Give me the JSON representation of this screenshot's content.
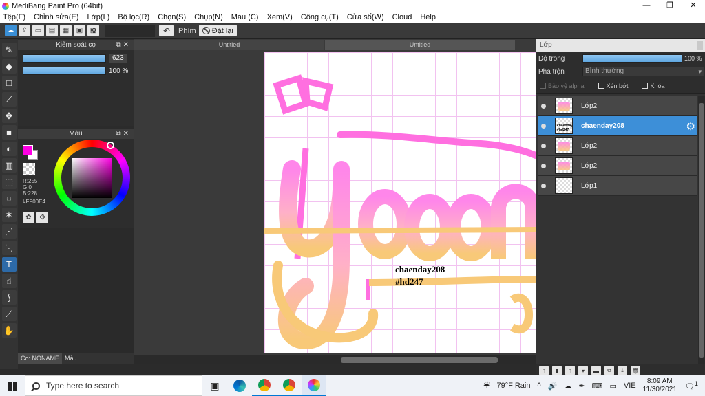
{
  "window": {
    "title": "MediBang Paint Pro (64bit)",
    "minimize": "—",
    "maximize": "❐",
    "close": "✕"
  },
  "menu": [
    "Tệp(F)",
    "Chỉnh sửa(E)",
    "Lớp(L)",
    "Bộ lọc(R)",
    "Chọn(S)",
    "Chụp(N)",
    "Màu (C)",
    "Xem(V)",
    "Công cụ(T)",
    "Cửa sổ(W)",
    "Cloud",
    "Help"
  ],
  "toolbar": {
    "phim_label": "Phím",
    "reset_label": "Đặt lại"
  },
  "brush_panel": {
    "title": "Kiểm soát cọ",
    "size_value": "623",
    "opacity_value": "100 %"
  },
  "color_panel": {
    "title": "Màu",
    "r": "R:255",
    "g": "G:0",
    "b": "B:228",
    "hex": "#FF00E4",
    "primary_color": "#FF00E4",
    "secondary_color": "#FFFFFF"
  },
  "bottom_tabs": {
    "brush": "Co: NONAME",
    "color": "Màu"
  },
  "documents": {
    "tab1": "Untitled",
    "tab2": "Untitled"
  },
  "canvas_text": {
    "line1": "chaenday208",
    "line2": "#hd247"
  },
  "layer_panel": {
    "title": "Lớp",
    "opacity_label": "Độ trong",
    "opacity_value": "100 %",
    "blend_label": "Pha trộn",
    "blend_value": "Bình thường",
    "protect_alpha": "Bảo vệ alpha",
    "clipping": "Xén bớt",
    "lock": "Khóa",
    "layers": [
      {
        "name": "Lớp2"
      },
      {
        "name": "chaenday208",
        "thumb_text": "chaenday208 #hd247"
      },
      {
        "name": "Lớp2"
      },
      {
        "name": "Lớp2"
      },
      {
        "name": "Lớp1"
      }
    ]
  },
  "taskbar": {
    "search_placeholder": "Type here to search",
    "weather": "79°F  Rain",
    "lang": "VIE",
    "time": "8:09 AM",
    "date": "11/30/2021",
    "notif_count": "1"
  }
}
